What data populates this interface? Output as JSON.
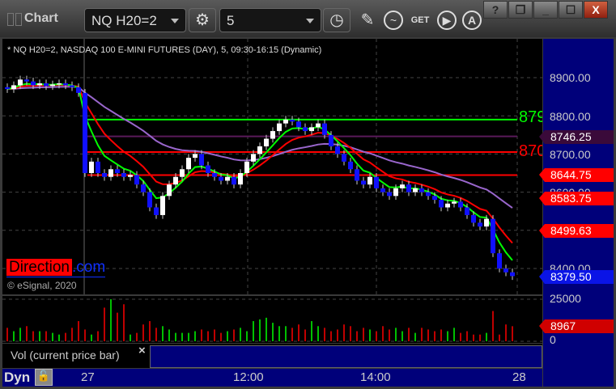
{
  "window": {
    "title": "Chart",
    "help": "?",
    "minimize": "_",
    "close": "X"
  },
  "toolbar": {
    "symbol": "NQ H20=2",
    "interval": "5",
    "get_label": "GET",
    "icons": [
      "settings-icon",
      "clock-icon",
      "pencil-icon",
      "chart-style-icon",
      "get-data-icon",
      "play-icon",
      "text-icon"
    ]
  },
  "chart": {
    "description": "* NQ H20=2, NASDAQ 100 E-MINI FUTURES (DAY), 5, 09:30-16:15 (Dynamic)",
    "watermark": "Direction",
    "watermark_suffix": ".com",
    "copyright": "© eSignal, 2020",
    "level_labels": [
      "879",
      "870"
    ],
    "colors": {
      "up": "#ffffff",
      "down": "#1010ff",
      "green": "#00ff00",
      "red": "#ff0000",
      "purple": "#9966cc",
      "axis": "#00007a"
    }
  },
  "price_axis": {
    "ticks": [
      "8900.00",
      "8800.00",
      "8700.00",
      "8600.00",
      "8400.00"
    ],
    "tags": [
      {
        "value": "8746.25",
        "color": "#3a0a3a"
      },
      {
        "value": "8644.75",
        "color": "#ff0000"
      },
      {
        "value": "8583.75",
        "color": "#ff0000"
      },
      {
        "value": "8499.63",
        "color": "#ff0000"
      },
      {
        "value": "8379.50",
        "color": "#0a14e6"
      }
    ]
  },
  "volume": {
    "ticks": [
      "25000",
      "0"
    ],
    "last": "8967",
    "study_label": "Vol (current price bar)",
    "close": "×"
  },
  "time_axis": {
    "mode": "Dyn",
    "labels": [
      "27",
      "12:00",
      "14:00",
      "28"
    ]
  },
  "chart_data": {
    "type": "candlestick",
    "ylim": [
      8350,
      8940
    ],
    "closes": [
      8870,
      8880,
      8895,
      8890,
      8880,
      8885,
      8878,
      8882,
      8885,
      8880,
      8875,
      8860,
      8650,
      8680,
      8650,
      8640,
      8660,
      8650,
      8640,
      8645,
      8620,
      8600,
      8560,
      8540,
      8590,
      8620,
      8640,
      8660,
      8690,
      8700,
      8670,
      8650,
      8640,
      8630,
      8640,
      8620,
      8650,
      8680,
      8700,
      8720,
      8740,
      8760,
      8780,
      8790,
      8785,
      8770,
      8760,
      8770,
      8780,
      8750,
      8720,
      8700,
      8680,
      8660,
      8630,
      8620,
      8640,
      8610,
      8600,
      8590,
      8610,
      8620,
      8600,
      8610,
      8600,
      8590,
      8580,
      8560,
      8570,
      8575,
      8560,
      8540,
      8520,
      8510,
      8530,
      8440,
      8400,
      8390,
      8380
    ],
    "volumes": [
      8000,
      6000,
      8000,
      9000,
      6000,
      6000,
      6000,
      5000,
      4000,
      5000,
      8000,
      12000,
      7000,
      4000,
      6000,
      20000,
      25000,
      17000,
      22000,
      4000,
      5000,
      10000,
      12000,
      8000,
      9000,
      7000,
      5000,
      5000,
      5000,
      6000,
      7000,
      6000,
      7000,
      5000,
      6000,
      7000,
      8000,
      6000,
      12000,
      13000,
      14000,
      11000,
      9000,
      9000,
      8000,
      10000,
      7000,
      12000,
      9000,
      8000,
      6000,
      7000,
      10000,
      9000,
      6000,
      8000,
      7000,
      6000,
      9000,
      7000,
      8000,
      6000,
      8000,
      5000,
      8000,
      7000,
      6000,
      7000,
      6000,
      8000,
      5000,
      6000,
      4000,
      4000,
      5000,
      18000,
      4000,
      10000,
      8967
    ],
    "levels": [
      {
        "price": 8790,
        "color": "#00ff00"
      },
      {
        "price": 8746.25,
        "color": "#5a1a5a"
      },
      {
        "price": 8705,
        "color": "#ff0000"
      },
      {
        "price": 8644.75,
        "color": "#ff0000"
      }
    ]
  }
}
